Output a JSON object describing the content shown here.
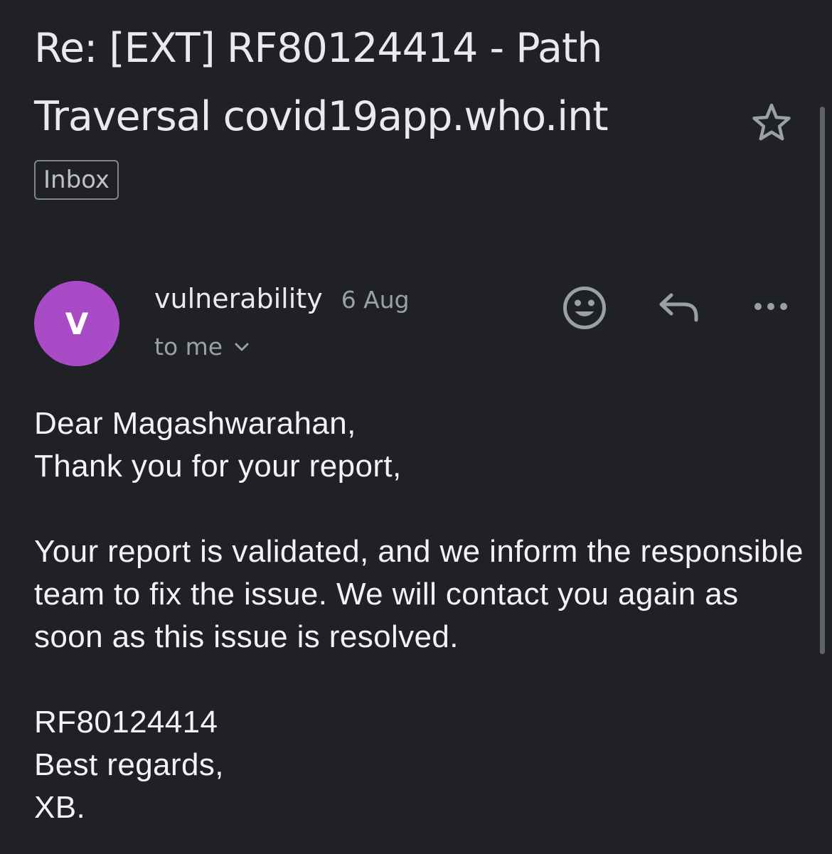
{
  "email": {
    "subject_line1": "Re: [EXT] RF80124414 - Path",
    "subject_line2": "Traversal covid19app.who.int",
    "label": "Inbox"
  },
  "sender": {
    "avatar_letter": "V",
    "avatar_color": "#a94bc6",
    "name": "vulnerability",
    "date": "6 Aug",
    "recipient": "to me"
  },
  "actions": {
    "icons": [
      "star-icon",
      "emoji-reaction-icon",
      "reply-icon",
      "more-options-icon",
      "chevron-down-icon"
    ]
  },
  "body": {
    "greeting": "Dear Magashwarahan,",
    "thanks": "Thank you for your report,",
    "paragraph": "Your report is validated, and we inform the responsible team to fix the issue. We will contact you again as soon as this issue is resolved.",
    "reference": "RF80124414",
    "closing": "Best regards,",
    "signature": "XB."
  },
  "colors": {
    "background": "#202124",
    "text": "#e8eaed",
    "muted": "#9aa0a6"
  }
}
